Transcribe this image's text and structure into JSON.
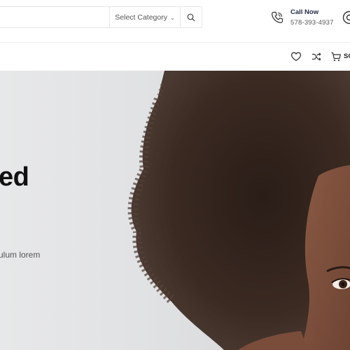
{
  "header": {
    "search": {
      "placeholder": "",
      "value": ""
    },
    "category": {
      "selected": "Select Category"
    },
    "call": {
      "title": "Call Now",
      "number": "578-393-4937"
    }
  },
  "nav": {
    "cart_label": "SC"
  },
  "hero": {
    "heading": "ed",
    "text": "ulum lorem"
  },
  "icons": [
    "search-icon",
    "phone-icon",
    "support-icon",
    "heart-icon",
    "shuffle-icon",
    "cart-icon",
    "chevron-down-icon"
  ],
  "colors": {
    "accent": "#1f2a44",
    "border": "#e6e6e6",
    "hero_bg": "#e2e3e4"
  }
}
